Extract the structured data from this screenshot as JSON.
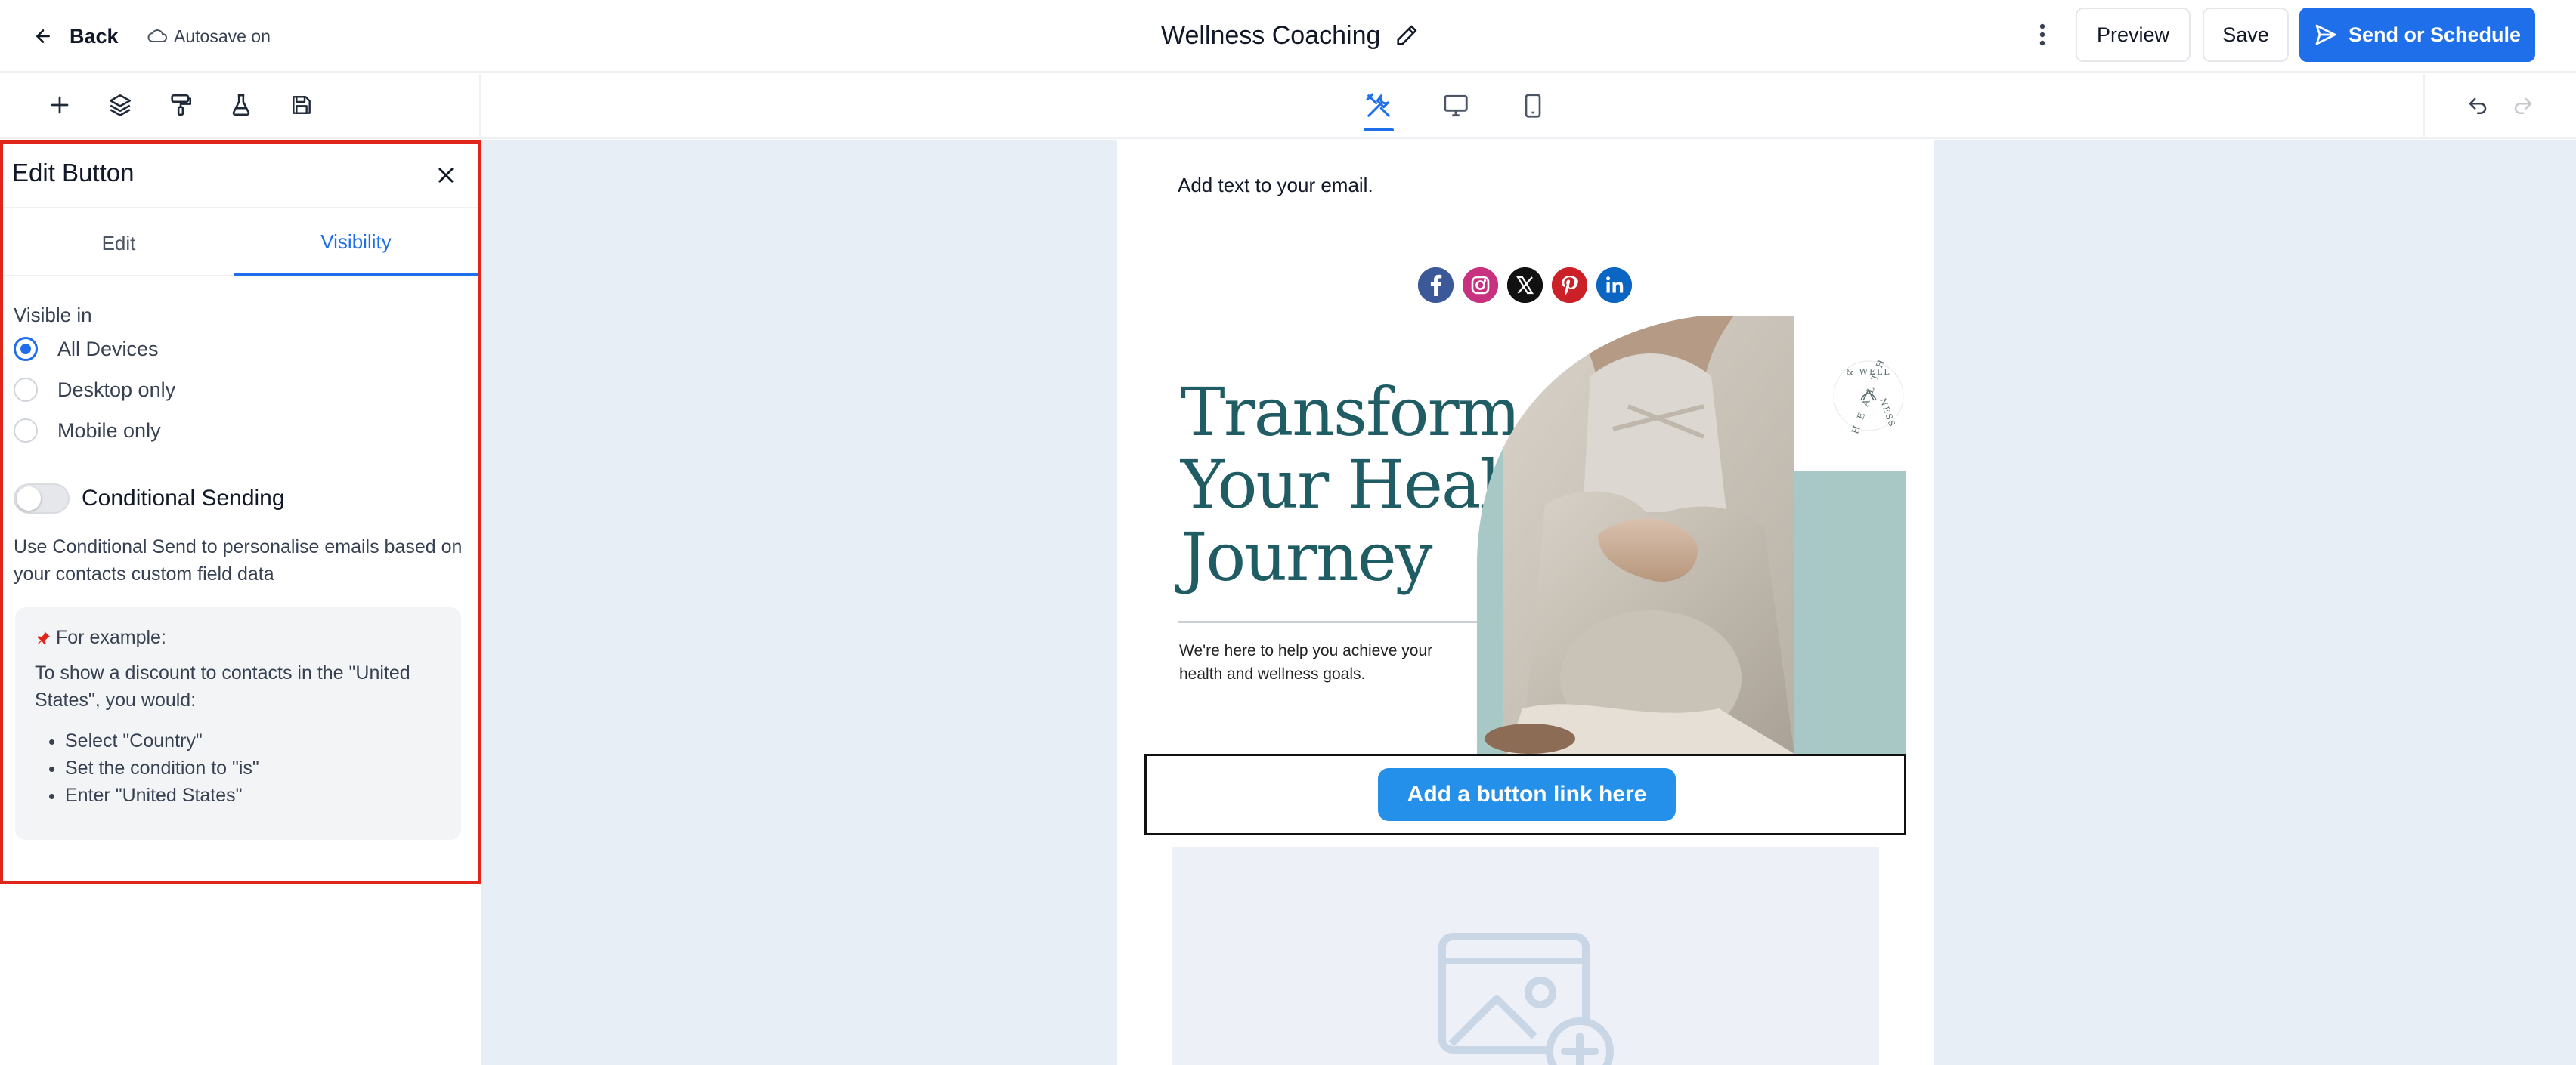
{
  "header": {
    "back_label": "Back",
    "autosave_label": "Autosave on",
    "title": "Wellness Coaching",
    "preview_label": "Preview",
    "save_label": "Save",
    "send_label": "Send or Schedule"
  },
  "toolbar": {
    "left_icons": [
      "plus-icon",
      "layers-icon",
      "paint-roller-icon",
      "flask-icon",
      "save-icon"
    ],
    "view_modes": [
      "design-tools-icon",
      "desktop-icon",
      "mobile-icon"
    ],
    "active_view": "design-tools-icon"
  },
  "panel": {
    "title": "Edit Button",
    "tabs": [
      "Edit",
      "Visibility"
    ],
    "active_tab": "Visibility",
    "visible_in_label": "Visible in",
    "options": [
      {
        "label": "All Devices",
        "checked": true
      },
      {
        "label": "Desktop only",
        "checked": false
      },
      {
        "label": "Mobile only",
        "checked": false
      }
    ],
    "conditional_label": "Conditional Sending",
    "conditional_enabled": false,
    "conditional_desc": "Use Conditional Send to personalise emails based on your contacts custom field data",
    "example": {
      "title": "For example:",
      "text": "To show a discount to contacts in the \"United States\", you would:",
      "steps": [
        "Select \"Country\"",
        "Set the condition to \"is\"",
        "Enter \"United States\""
      ]
    }
  },
  "email": {
    "text_block": "Add text to your email.",
    "social_icons": [
      "facebook-icon",
      "instagram-icon",
      "x-icon",
      "pinterest-icon",
      "linkedin-icon"
    ],
    "hero_title": [
      "Transform",
      "Your Health",
      "Journey"
    ],
    "hero_subtitle": "We're here to help you achieve your health and wellness goals.",
    "badge_text": "HEALTH & WELLNESS",
    "button_label": "Add a button link here"
  },
  "colors": {
    "accent": "#1f6feb",
    "highlight_border": "#e0261b",
    "canvas_bg": "#e8eef6",
    "cta": "#2490ea",
    "hero_teal": "#1f5c63"
  }
}
